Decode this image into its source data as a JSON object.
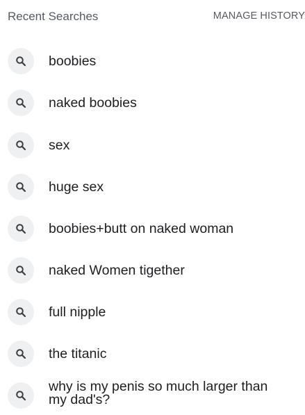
{
  "header": {
    "title": "Recent Searches",
    "manage_label": "MANAGE HISTORY"
  },
  "searches": [
    {
      "query": "boobies",
      "icon": "search-icon"
    },
    {
      "query": "naked boobies",
      "icon": "search-icon"
    },
    {
      "query": "sex",
      "icon": "search-icon"
    },
    {
      "query": "huge sex",
      "icon": "search-icon"
    },
    {
      "query": "boobies+butt on naked woman",
      "icon": "search-icon"
    },
    {
      "query": "naked Women tigether",
      "icon": "search-icon"
    },
    {
      "query": "full nipple",
      "icon": "search-icon"
    },
    {
      "query": "the titanic",
      "icon": "search-icon"
    },
    {
      "query": "why is my penis so much larger than my dad's?",
      "icon": "search-icon"
    }
  ],
  "colors": {
    "icon_bg": "#eff0f2",
    "icon_fg": "#3a3d42",
    "text": "#1c1e21",
    "header_text": "#555b63"
  }
}
